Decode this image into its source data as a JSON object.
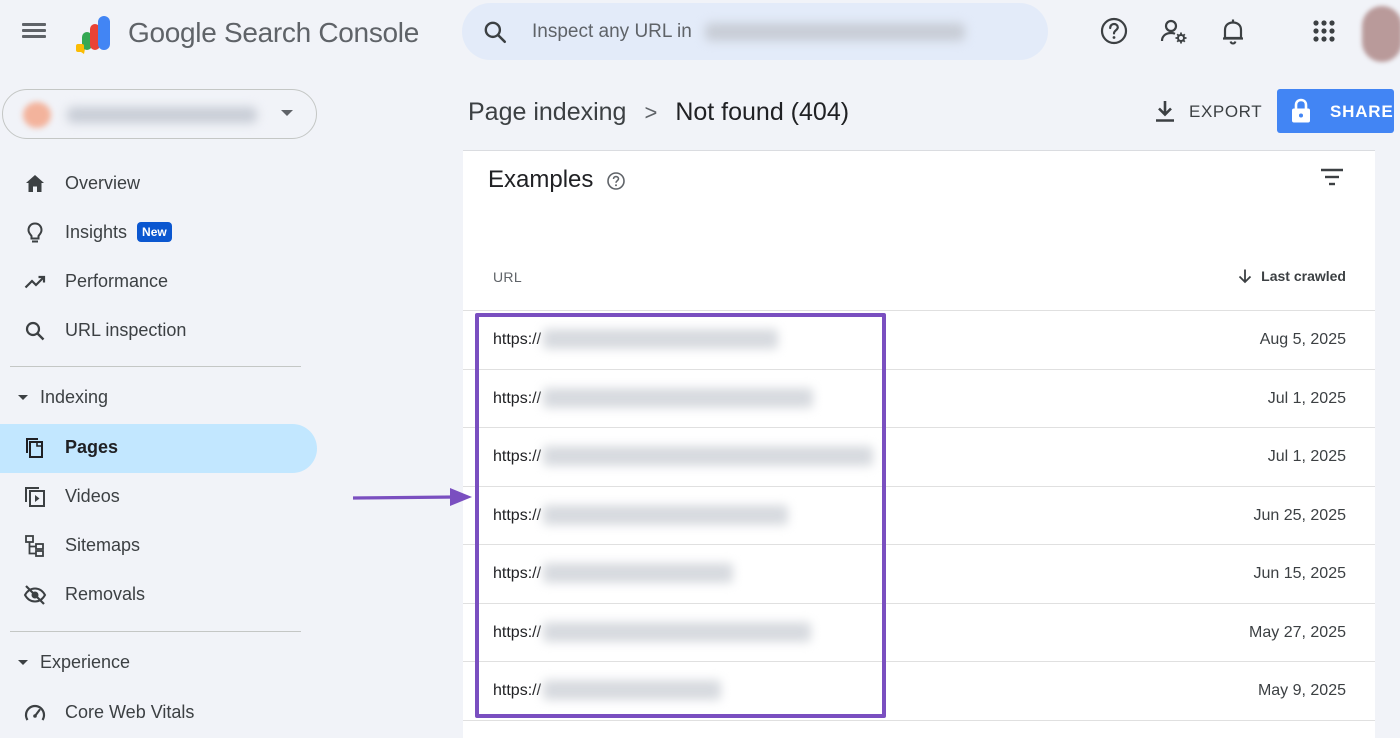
{
  "header": {
    "brand": "Google Search Console",
    "search_placeholder": "Inspect any URL in"
  },
  "sidebar": {
    "items": [
      {
        "label": "Overview",
        "icon": "home-icon"
      },
      {
        "label": "Insights",
        "icon": "lightbulb-icon",
        "badge": "New"
      },
      {
        "label": "Performance",
        "icon": "trending-up-icon"
      },
      {
        "label": "URL inspection",
        "icon": "search-icon"
      }
    ],
    "sections": [
      {
        "title": "Indexing",
        "items": [
          {
            "label": "Pages",
            "icon": "pages-icon",
            "active": true
          },
          {
            "label": "Videos",
            "icon": "video-icon"
          },
          {
            "label": "Sitemaps",
            "icon": "sitemap-icon"
          },
          {
            "label": "Removals",
            "icon": "eye-off-icon"
          }
        ]
      },
      {
        "title": "Experience",
        "items": [
          {
            "label": "Core Web Vitals",
            "icon": "speedometer-icon"
          }
        ]
      }
    ]
  },
  "breadcrumb": {
    "parent": "Page indexing",
    "separator": ">",
    "current": "Not found (404)"
  },
  "actions": {
    "export_label": "EXPORT",
    "share_label": "SHARE"
  },
  "examples": {
    "title": "Examples",
    "columns": {
      "url": "URL",
      "last_crawled": "Last crawled"
    },
    "rows": [
      {
        "url_prefix": "https://",
        "date": "Aug 5, 2025"
      },
      {
        "url_prefix": "https://",
        "date": "Jul 1, 2025"
      },
      {
        "url_prefix": "https://",
        "date": "Jul 1, 2025"
      },
      {
        "url_prefix": "https://",
        "date": "Jun 25, 2025"
      },
      {
        "url_prefix": "https://",
        "date": "Jun 15, 2025"
      },
      {
        "url_prefix": "https://",
        "date": "May 27, 2025"
      },
      {
        "url_prefix": "https://",
        "date": "May 9, 2025"
      }
    ]
  },
  "colors": {
    "accent_blue": "#4285f4",
    "active_nav_bg": "#c2e7ff",
    "badge_blue": "#0b57d0",
    "annotation_purple": "#7a4fc0"
  }
}
